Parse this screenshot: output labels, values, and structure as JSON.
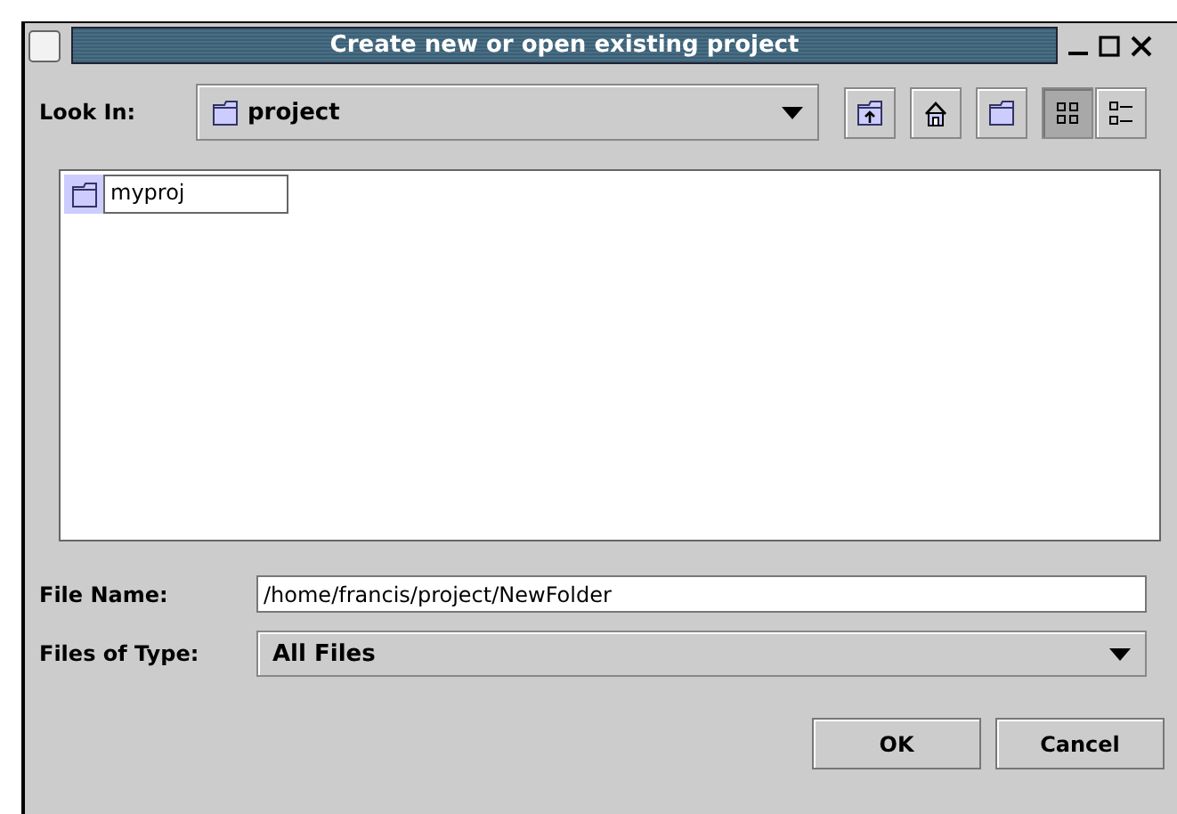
{
  "window": {
    "title": "Create new or open existing project"
  },
  "look_in": {
    "label": "Look In:",
    "value": "project"
  },
  "toolbar": [
    {
      "kind": "up",
      "selected": false
    },
    {
      "kind": "home",
      "selected": false
    },
    {
      "kind": "new-folder",
      "selected": false
    },
    {
      "kind": "list-view",
      "selected": true
    },
    {
      "kind": "details-view",
      "selected": false
    }
  ],
  "files": [
    {
      "name": "myproj",
      "selected": true
    }
  ],
  "file_name": {
    "label": "File Name:",
    "value": "/home/francis/project/NewFolder"
  },
  "file_type": {
    "label": "Files of Type:",
    "value": "All Files"
  },
  "buttons": [
    "OK",
    "Cancel"
  ]
}
